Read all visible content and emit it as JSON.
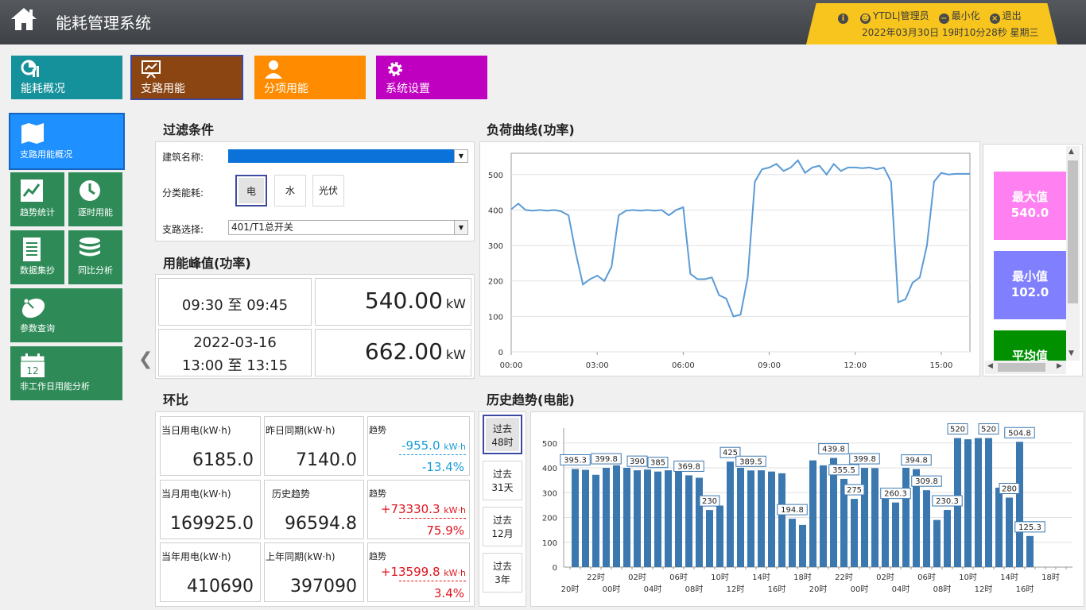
{
  "header": {
    "title": "能耗管理系统",
    "user": "YTDL|管理员",
    "minimize": "最小化",
    "exit": "退出",
    "datetime": "2022年03月30日 19时10分28秒 星期三"
  },
  "top_tabs": [
    {
      "label": "能耗概况",
      "color": "#14919b"
    },
    {
      "label": "支路用能",
      "color": "#8b4513"
    },
    {
      "label": "分项用能",
      "color": "#ff8c00"
    },
    {
      "label": "系统设置",
      "color": "#c000c0"
    }
  ],
  "side_nav": [
    {
      "label": "支路用能概况"
    },
    {
      "label": "趋势统计"
    },
    {
      "label": "逐时用能"
    },
    {
      "label": "数据集抄"
    },
    {
      "label": "同比分析"
    },
    {
      "label": "参数查询"
    },
    {
      "label": "非工作日用能分析",
      "day": "12"
    }
  ],
  "filter": {
    "title": "过滤条件",
    "building_label": "建筑名称:",
    "category_label": "分类能耗:",
    "categories": [
      "电",
      "水",
      "光伏"
    ],
    "branch_label": "支路选择:",
    "branch_value": "401/T1总开关"
  },
  "peak": {
    "title": "用能峰值(功率)",
    "rows": [
      {
        "date": "",
        "time": "09:30  至  09:45",
        "value": "540.00",
        "unit": "kW"
      },
      {
        "date": "2022-03-16",
        "time": "13:00  至  13:15",
        "value": "662.00",
        "unit": "kW"
      }
    ]
  },
  "huanbi": {
    "title": "环比",
    "rows": [
      {
        "cur_label": "当日用电(kW·h)",
        "cur_value": "6185.0",
        "prev_label": "昨日同期(kW·h)",
        "prev_value": "7140.0",
        "trend_label": "趋势",
        "trend_diff": "-955.0",
        "trend_unit": "kW·h",
        "trend_pct": "-13.4%",
        "trend_color": "#1a9cd8"
      },
      {
        "cur_label": "当月用电(kW·h)",
        "cur_value": "169925.0",
        "prev_label": "历史趋势",
        "prev_value": "96594.8",
        "trend_label": "趋势",
        "trend_diff": "+73330.3",
        "trend_unit": "kW·h",
        "trend_pct": "75.9%",
        "trend_color": "#e0141e"
      },
      {
        "cur_label": "当年用电(kW·h)",
        "cur_value": "410690",
        "prev_label": "上年同期(kW·h)",
        "prev_value": "397090",
        "trend_label": "趋势",
        "trend_diff": "+13599.8",
        "trend_unit": "kW·h",
        "trend_pct": "3.4%",
        "trend_color": "#e0141e"
      }
    ]
  },
  "load_title": "负荷曲线(功率)",
  "stats": [
    {
      "label": "最大值",
      "value": "540.0",
      "color": "#ff80f0"
    },
    {
      "label": "最小值",
      "value": "102.0",
      "color": "#8080ff"
    },
    {
      "label": "平均值",
      "value": "",
      "color": "#009000"
    }
  ],
  "history": {
    "title": "历史趋势(电能)",
    "buttons": [
      {
        "line1": "过去",
        "line2": "48时"
      },
      {
        "line1": "过去",
        "line2": "31天"
      },
      {
        "line1": "过去",
        "line2": "12月"
      },
      {
        "line1": "过去",
        "line2": "3年"
      }
    ]
  },
  "chart_data": [
    {
      "type": "line",
      "title": "",
      "ylim": [
        0,
        560
      ],
      "yticks": [
        0,
        100,
        200,
        300,
        400,
        500
      ],
      "xlim": [
        0,
        16
      ],
      "xticks": [
        0,
        3,
        6,
        9,
        12,
        15
      ],
      "xticklabels": [
        "00:00",
        "03:00",
        "06:00",
        "09:00",
        "12:00",
        "15:00"
      ],
      "grid": true,
      "color": "#5b9bd5",
      "x": [
        0,
        0.25,
        0.5,
        0.75,
        1,
        1.25,
        1.5,
        1.75,
        2,
        2.25,
        2.5,
        2.75,
        3,
        3.25,
        3.5,
        3.75,
        4,
        4.25,
        4.5,
        4.75,
        5,
        5.25,
        5.5,
        5.75,
        6,
        6.25,
        6.5,
        6.75,
        7,
        7.25,
        7.5,
        7.75,
        8,
        8.25,
        8.5,
        8.75,
        9,
        9.25,
        9.5,
        9.75,
        10,
        10.25,
        10.5,
        10.75,
        11,
        11.25,
        11.5,
        11.75,
        12,
        12.25,
        12.5,
        12.75,
        13,
        13.25,
        13.5,
        13.75,
        14,
        14.25,
        14.5,
        14.75,
        15,
        15.25,
        15.5,
        15.75,
        16
      ],
      "values": [
        402,
        418,
        400,
        398,
        400,
        398,
        400,
        396,
        385,
        280,
        190,
        205,
        215,
        200,
        240,
        385,
        398,
        400,
        398,
        400,
        398,
        400,
        385,
        400,
        408,
        220,
        205,
        205,
        210,
        160,
        150,
        100,
        105,
        210,
        480,
        515,
        520,
        530,
        510,
        520,
        540,
        505,
        520,
        525,
        500,
        530,
        510,
        520,
        520,
        518,
        520,
        515,
        520,
        480,
        140,
        148,
        195,
        210,
        300,
        480,
        505,
        500,
        502,
        502,
        502
      ]
    },
    {
      "type": "bar",
      "title": "",
      "ylim": [
        0,
        560
      ],
      "yticks": [
        0,
        100,
        200,
        300,
        400,
        500
      ],
      "grid": true,
      "color": "#3c78b0",
      "values": [
        395.3,
        392,
        372,
        399.8,
        410,
        400,
        390,
        393,
        385,
        390,
        395,
        369.8,
        360,
        230,
        248,
        425,
        400,
        389.5,
        390,
        385,
        378,
        194.8,
        170,
        430,
        410,
        439.8,
        355.5,
        275,
        399.8,
        399,
        295,
        260.3,
        400,
        394.8,
        309.8,
        190,
        230.3,
        520,
        515,
        520,
        520,
        320,
        280,
        504.8,
        125.3
      ],
      "value_labels": [
        {
          "i": 0,
          "text": "395.3"
        },
        {
          "i": 3,
          "text": "399.8"
        },
        {
          "i": 6,
          "text": "390"
        },
        {
          "i": 8,
          "text": "385"
        },
        {
          "i": 11,
          "text": "369.8"
        },
        {
          "i": 13,
          "text": "230"
        },
        {
          "i": 15,
          "text": "425"
        },
        {
          "i": 17,
          "text": "389.5"
        },
        {
          "i": 21,
          "text": "194.8"
        },
        {
          "i": 25,
          "text": "439.8"
        },
        {
          "i": 26,
          "text": "355.5"
        },
        {
          "i": 27,
          "text": "275"
        },
        {
          "i": 28,
          "text": "399.8"
        },
        {
          "i": 31,
          "text": "260.3"
        },
        {
          "i": 33,
          "text": "394.8"
        },
        {
          "i": 34,
          "text": "309.8"
        },
        {
          "i": 36,
          "text": "230.3"
        },
        {
          "i": 37,
          "text": "520"
        },
        {
          "i": 40,
          "text": "520"
        },
        {
          "i": 42,
          "text": "280"
        },
        {
          "i": 43,
          "text": "504.8"
        },
        {
          "i": 44,
          "text": "125.3"
        }
      ],
      "xticklabels_top": [
        "22时",
        "02时",
        "06时",
        "10时",
        "14时",
        "18时",
        "22时",
        "02时",
        "06时",
        "10时",
        "14时",
        "18时"
      ],
      "xticklabels_bottom": [
        "20时",
        "00时",
        "04时",
        "08时",
        "12时",
        "16时",
        "20时",
        "00时",
        "04时",
        "08时",
        "12时",
        "16时"
      ]
    }
  ]
}
